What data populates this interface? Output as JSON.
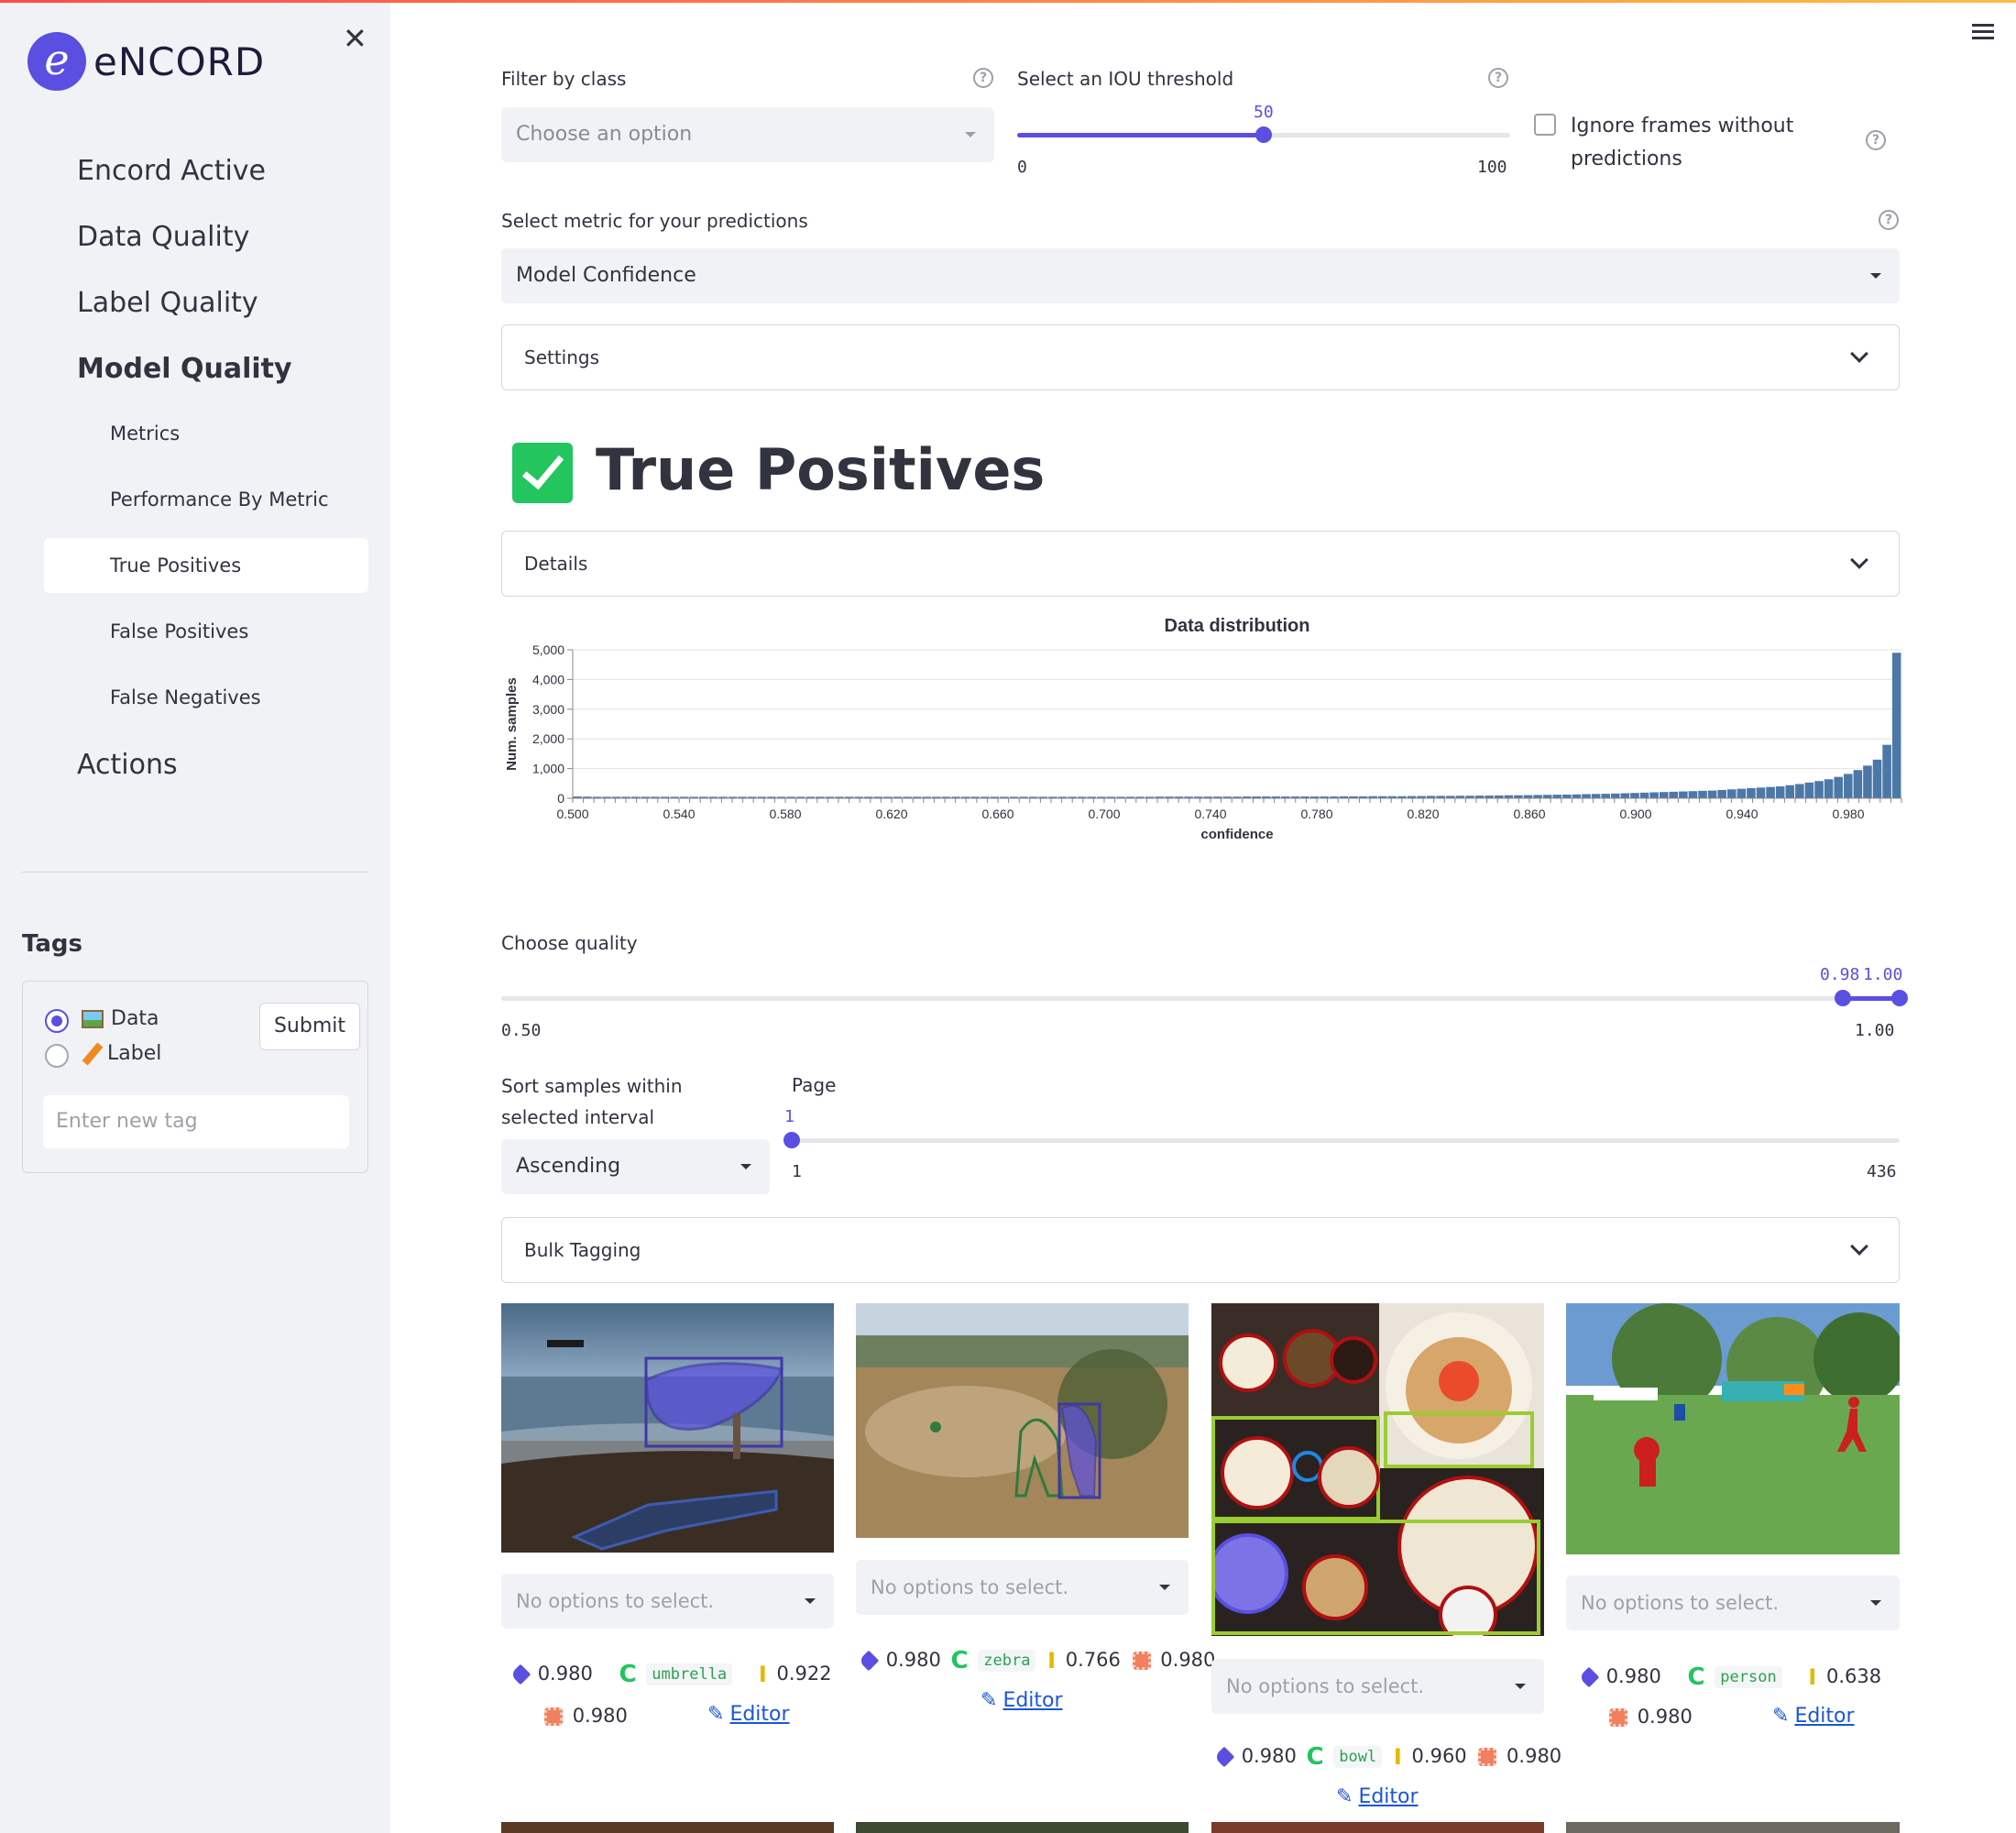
{
  "brand": {
    "name": "eNCORD"
  },
  "sidebar": {
    "nav": [
      "Encord Active",
      "Data Quality",
      "Label Quality",
      "Model Quality",
      "Actions"
    ],
    "subnav": [
      "Metrics",
      "Performance By Metric",
      "True Positives",
      "False Positives",
      "False Negatives"
    ],
    "tags_title": "Tags",
    "radio": [
      {
        "label": "Data",
        "icon": "picture-icon",
        "selected": true
      },
      {
        "label": "Label",
        "icon": "pencil-icon",
        "selected": false
      }
    ],
    "submit_label": "Submit",
    "tag_placeholder": "Enter new tag"
  },
  "filters": {
    "class_label": "Filter by class",
    "class_placeholder": "Choose an option",
    "iou_label": "Select an IOU threshold",
    "iou_value": "50",
    "iou_min": "0",
    "iou_max": "100",
    "iou_fraction": 0.5,
    "ignore_label": "Ignore frames without predictions",
    "ignore_checked": false,
    "metric_label": "Select metric for your predictions",
    "metric_value": "Model Confidence",
    "settings_label": "Settings"
  },
  "section": {
    "title": "True Positives",
    "details_label": "Details"
  },
  "chart_data": {
    "type": "bar",
    "title": "Data distribution",
    "xlabel": "confidence",
    "ylabel": "Num. samples",
    "xlim": [
      0.5,
      1.0
    ],
    "ylim": [
      0,
      5000
    ],
    "yticks": [
      "5,000",
      "4,000",
      "3,000",
      "2,000",
      "1,000",
      "0"
    ],
    "xticks": [
      "0.500",
      "0.540",
      "0.580",
      "0.620",
      "0.660",
      "0.700",
      "0.740",
      "0.780",
      "0.820",
      "0.860",
      "0.900",
      "0.940",
      "0.980"
    ],
    "bin_start": 0.5,
    "bin_width": 0.004,
    "values": [
      60,
      55,
      50,
      50,
      50,
      50,
      50,
      50,
      50,
      50,
      50,
      50,
      50,
      50,
      50,
      50,
      50,
      50,
      50,
      50,
      50,
      50,
      50,
      50,
      50,
      50,
      50,
      50,
      50,
      50,
      50,
      50,
      50,
      50,
      50,
      50,
      50,
      50,
      50,
      50,
      50,
      50,
      50,
      50,
      50,
      50,
      50,
      50,
      50,
      50,
      50,
      50,
      50,
      50,
      50,
      50,
      50,
      50,
      50,
      50,
      55,
      55,
      55,
      55,
      55,
      55,
      55,
      55,
      55,
      60,
      60,
      60,
      60,
      60,
      60,
      60,
      60,
      60,
      60,
      65,
      65,
      65,
      70,
      70,
      70,
      70,
      75,
      75,
      80,
      80,
      80,
      85,
      85,
      90,
      90,
      95,
      100,
      100,
      105,
      110,
      115,
      120,
      125,
      130,
      140,
      145,
      150,
      160,
      170,
      180,
      190,
      200,
      210,
      220,
      230,
      240,
      250,
      260,
      280,
      300,
      320,
      340,
      360,
      380,
      400,
      440,
      480,
      530,
      580,
      640,
      720,
      820,
      950,
      1100,
      1300,
      1800,
      4900
    ],
    "bar_color": "#4c78a8"
  },
  "quality": {
    "label": "Choose quality",
    "low": "0.50",
    "high": "1.00",
    "sel_low": "0.98",
    "sel_high": "1.00"
  },
  "sort": {
    "label": "Sort samples within selected interval",
    "value": "Ascending",
    "page_label": "Page",
    "page_value": "1",
    "page_min": "1",
    "page_max": "436"
  },
  "bulk_label": "Bulk Tagging",
  "cards": [
    {
      "placeholder": "No options to select.",
      "tag": "0.980",
      "cls": "umbrella",
      "iou": "0.922",
      "conf": "0.980",
      "editor": "Editor"
    },
    {
      "placeholder": "No options to select.",
      "tag": "0.980",
      "cls": "zebra",
      "iou": "0.766",
      "conf": "0.980",
      "editor": "Editor"
    },
    {
      "placeholder": "No options to select.",
      "tag": "0.980",
      "cls": "bowl",
      "iou": "0.960",
      "conf": "0.980",
      "editor": "Editor"
    },
    {
      "placeholder": "No options to select.",
      "tag": "0.980",
      "cls": "person",
      "iou": "0.638",
      "conf": "0.980",
      "editor": "Editor"
    }
  ]
}
